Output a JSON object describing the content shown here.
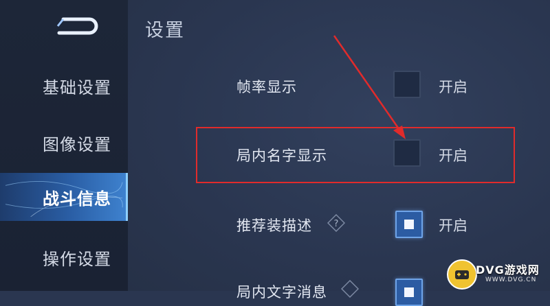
{
  "sidebar": {
    "back_icon": "back-arrow-icon",
    "items": [
      {
        "label": "基础设置",
        "active": false
      },
      {
        "label": "图像设置",
        "active": false
      },
      {
        "label": "战斗信息",
        "active": true
      },
      {
        "label": "操作设置",
        "active": false
      }
    ]
  },
  "main": {
    "title": "设置",
    "rows": [
      {
        "label": "帧率显示",
        "checked": false,
        "state": "开启",
        "help": false
      },
      {
        "label": "局内名字显示",
        "checked": false,
        "state": "开启",
        "help": false
      },
      {
        "label": "推荐装描述",
        "checked": true,
        "state": "开启",
        "help": true
      },
      {
        "label": "局内文字消息",
        "checked": true,
        "state": "",
        "help": true
      }
    ]
  },
  "annotation": {
    "color": "#e12b2b"
  },
  "watermark": {
    "title": "DVG游戏网",
    "subtitle": "WWW.DVG.CN"
  },
  "colors": {
    "accent": "#3f83d0",
    "checked": "#2c5ca3"
  }
}
